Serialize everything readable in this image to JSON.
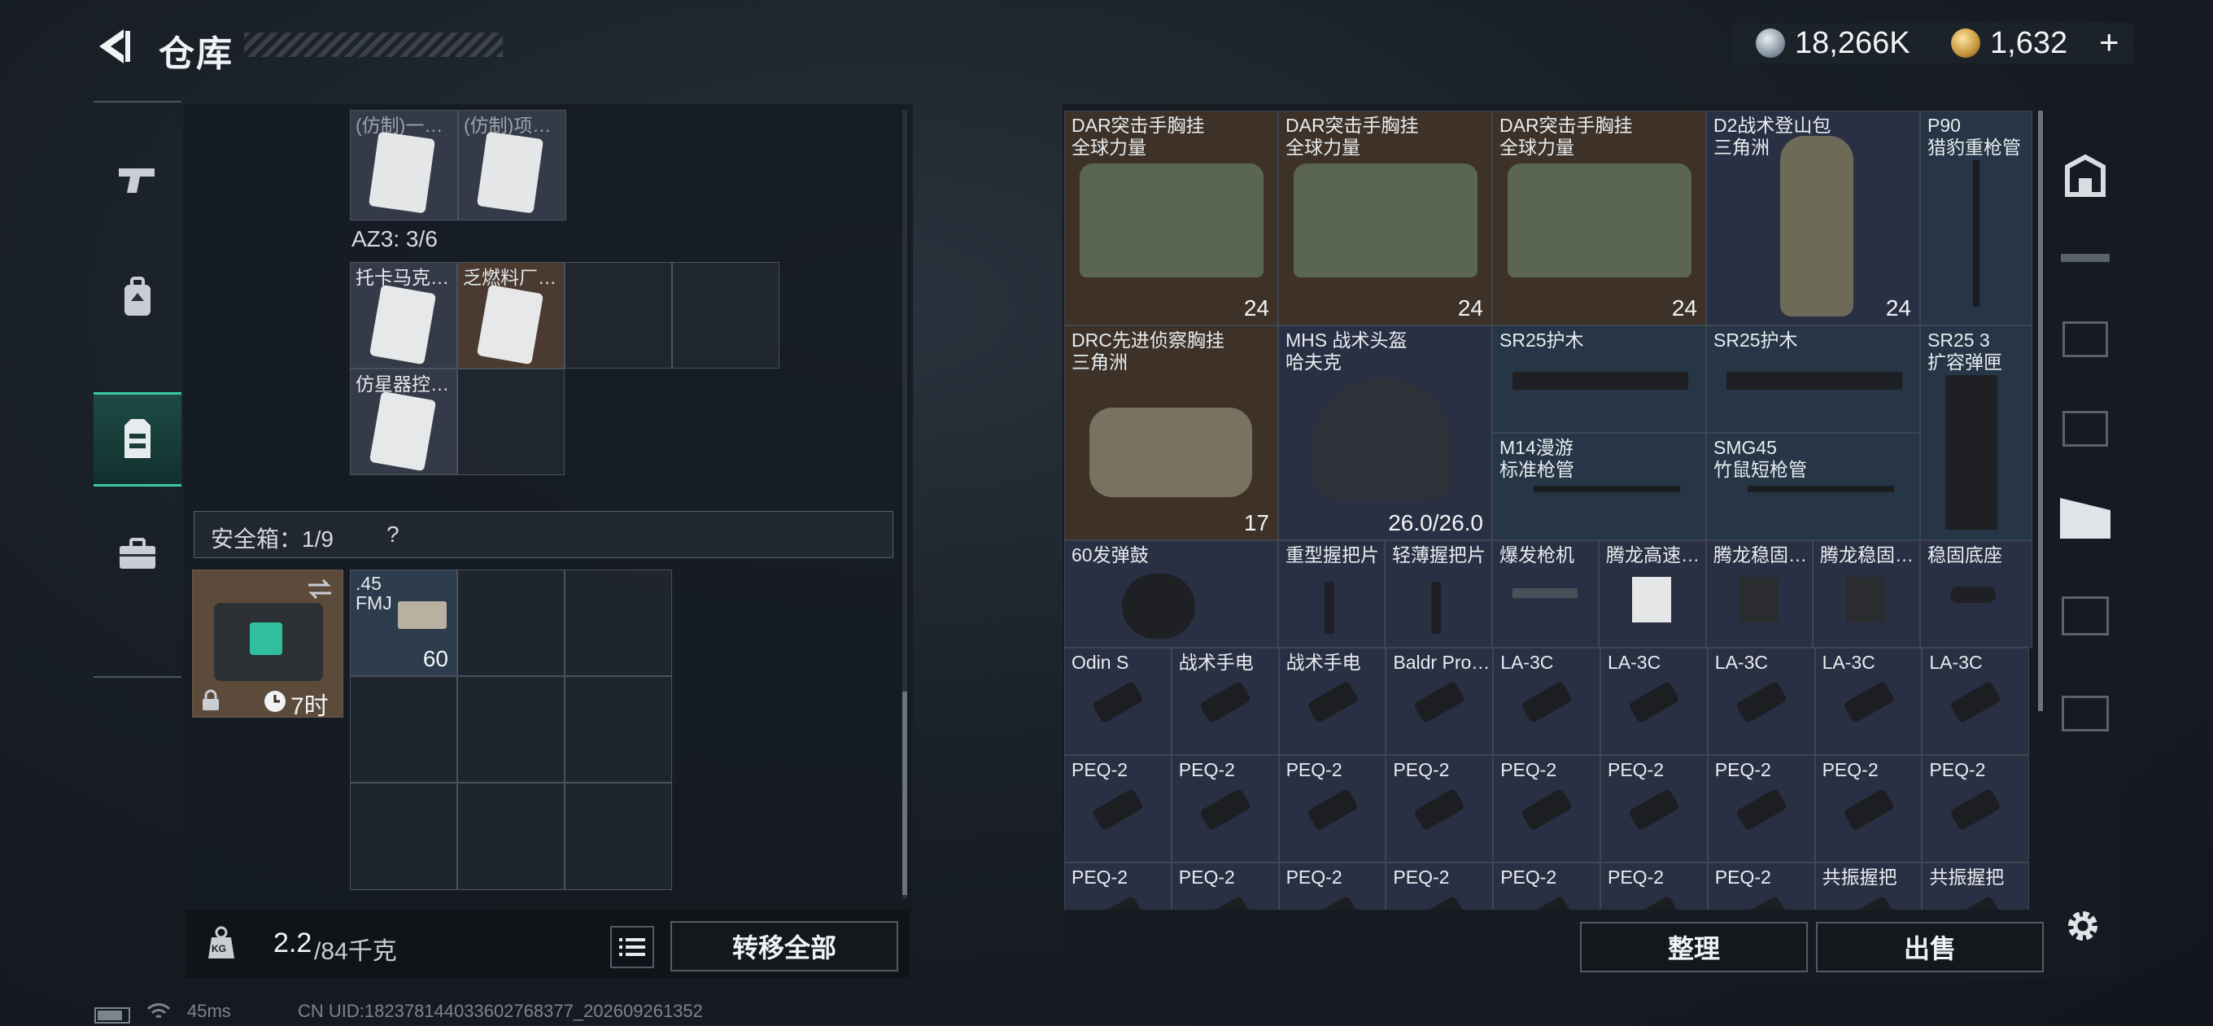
{
  "header": {
    "title": "仓库",
    "currencies": [
      {
        "icon": "silver-coin-icon",
        "value": "18,266K"
      },
      {
        "icon": "gold-coin-icon",
        "value": "1,632",
        "add": "+"
      }
    ]
  },
  "left_nav": [
    "pistol-icon",
    "backpack-icon",
    "chest-rig-icon",
    "briefcase-icon"
  ],
  "container_items": {
    "top_row": [
      "(仿制)一…",
      "(仿制)项…"
    ],
    "az3_label": "AZ3: 3/6",
    "az3_items": [
      "托卡马克…",
      "乏燃料厂…",
      "仿星器控…"
    ]
  },
  "safebox": {
    "label": "安全箱：1/9",
    "help": "?",
    "timer": "7时",
    "ammo": {
      "name": ".45\nFMJ",
      "count": "60"
    }
  },
  "weight": {
    "current": "2.2",
    "max": "/84千克",
    "kg_badge": "KG"
  },
  "buttons": {
    "transfer_all": "转移全部",
    "organize": "整理",
    "sell": "出售"
  },
  "warehouse": {
    "row1": [
      {
        "name": "DAR突击手胸挂\n全球力量",
        "count": "24"
      },
      {
        "name": "DAR突击手胸挂\n全球力量",
        "count": "24"
      },
      {
        "name": "DAR突击手胸挂\n全球力量",
        "count": "24"
      },
      {
        "name": "D2战术登山包\n三角洲",
        "count": "24"
      },
      {
        "name": "P90\n猎豹重枪管"
      }
    ],
    "row2": [
      {
        "name": "DRC先进侦察胸挂\n三角洲",
        "count": "17"
      },
      {
        "name": "MHS 战术头盔\n哈夫克",
        "durability": "26.0/26.0"
      },
      {
        "name": "SR25护木"
      },
      {
        "name": "SR25护木"
      },
      {
        "name": "SR25 3\n扩容弹匣"
      }
    ],
    "row3": [
      {
        "name": "M14漫游\n标准枪管"
      },
      {
        "name": "SMG45\n竹鼠短枪管"
      }
    ],
    "row4": [
      "60发弹鼓",
      "重型握把片",
      "轻薄握把片",
      "爆发枪机",
      "腾龙高速…",
      "腾龙稳固…",
      "腾龙稳固…",
      "稳固底座"
    ],
    "row5": [
      "Odin S",
      "战术手电",
      "战术手电",
      "Baldr Pro…",
      "LA-3C",
      "LA-3C",
      "LA-3C",
      "LA-3C",
      "LA-3C"
    ],
    "row6": [
      "PEQ-2",
      "PEQ-2",
      "PEQ-2",
      "PEQ-2",
      "PEQ-2",
      "PEQ-2",
      "PEQ-2",
      "PEQ-2",
      "PEQ-2"
    ],
    "row7": [
      "PEQ-2",
      "PEQ-2",
      "PEQ-2",
      "PEQ-2",
      "PEQ-2",
      "PEQ-2",
      "PEQ-2",
      "共振握把",
      "共振握把"
    ]
  },
  "right_tabs": [
    "all-items-icon",
    "rifle-icon",
    "tier-v-icon",
    "tier-iv-icon",
    "gti-attachment-icon",
    "gti-armor-icon",
    "gti-weapon-icon"
  ],
  "status_bar": {
    "ping": "45ms",
    "uid": "CN UID:182378144033602768377_202609261352"
  }
}
